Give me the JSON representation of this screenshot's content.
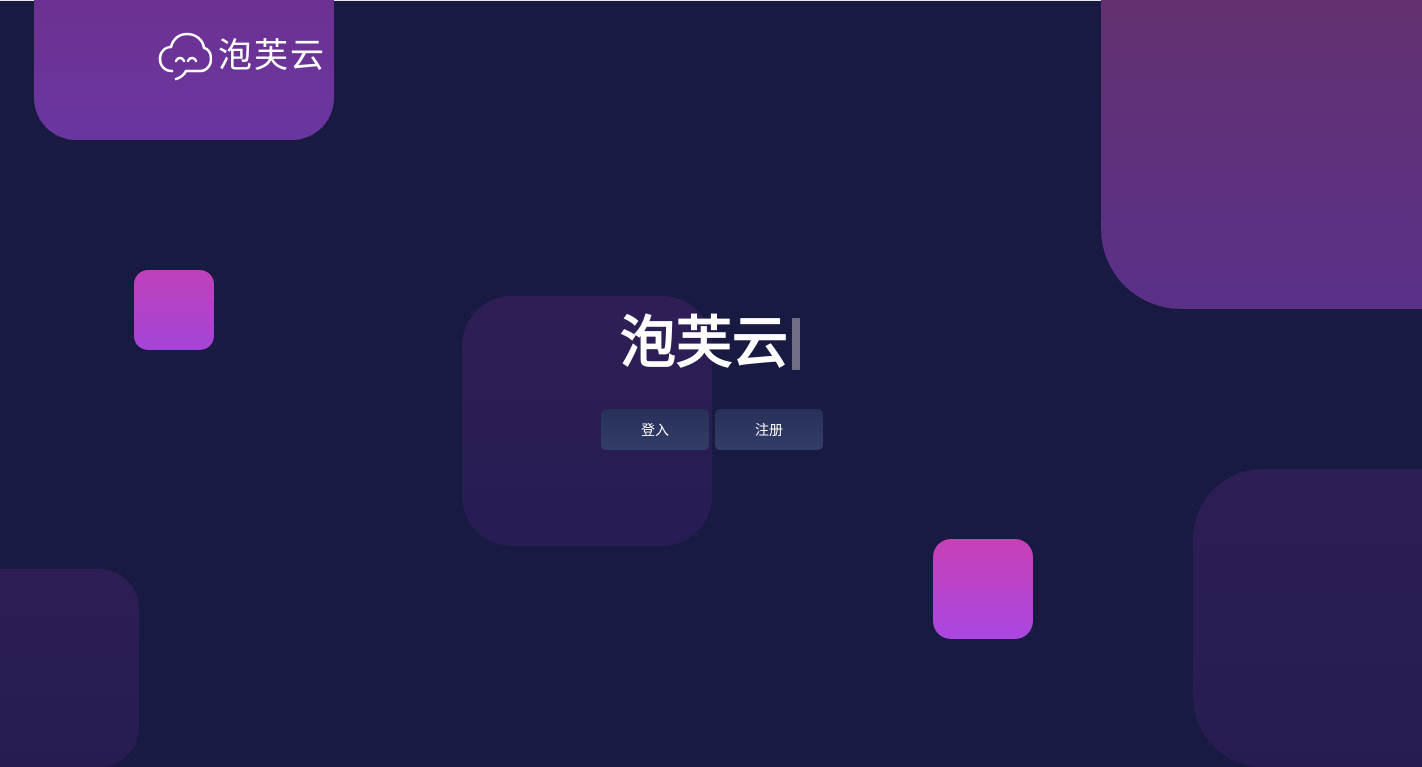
{
  "brand": {
    "logo_icon": "cloud-face-icon",
    "name": "泡芙云"
  },
  "hero": {
    "title": "泡芙云"
  },
  "actions": {
    "login_label": "登入",
    "register_label": "注册"
  },
  "colors": {
    "background": "#181a41",
    "logo_card": "#6936a0",
    "accent_pink": "#c840b6",
    "accent_purple": "#a947e0",
    "button": "#2d365f"
  }
}
